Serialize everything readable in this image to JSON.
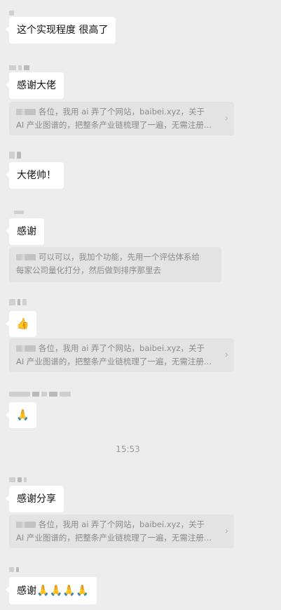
{
  "messages": {
    "m1": {
      "text": "这个实现程度 很高了"
    },
    "m2": {
      "text": "感谢大佬"
    },
    "q1": {
      "line1": "各位，我用 ai 弄了个网站，baibei.xyz，关于",
      "line2": "AI 产业图谱的，把整条产业链梳理了一遍，无需注册..."
    },
    "m3": {
      "text": "大佬帅！"
    },
    "m4": {
      "text": "感谢"
    },
    "q2": {
      "line1": "可以可以，我加个功能，先用一个评估体系给",
      "line2": "每家公司量化打分，然后做到排序那里去"
    },
    "m5": {
      "emoji": "👍"
    },
    "q3": {
      "line1": "各位，我用 ai 弄了个网站，baibei.xyz，关于",
      "line2": "AI 产业图谱的，把整条产业链梳理了一遍，无需注册..."
    },
    "m6": {
      "emoji": "🙏"
    },
    "time": {
      "text": "15:53"
    },
    "m7": {
      "text": "感谢分享"
    },
    "q4": {
      "line1": "各位，我用 ai 弄了个网站，baibei.xyz，关于",
      "line2": "AI 产业图谱的，把整条产业链梳理了一遍，无需注册..."
    },
    "m8": {
      "text": "感谢",
      "emoji": "🙏🙏🙏🙏"
    }
  },
  "icons": {
    "chevron": "›"
  },
  "colors": {
    "background": "#ededed",
    "bubble": "#ffffff",
    "quote": "#e3e3e3"
  }
}
